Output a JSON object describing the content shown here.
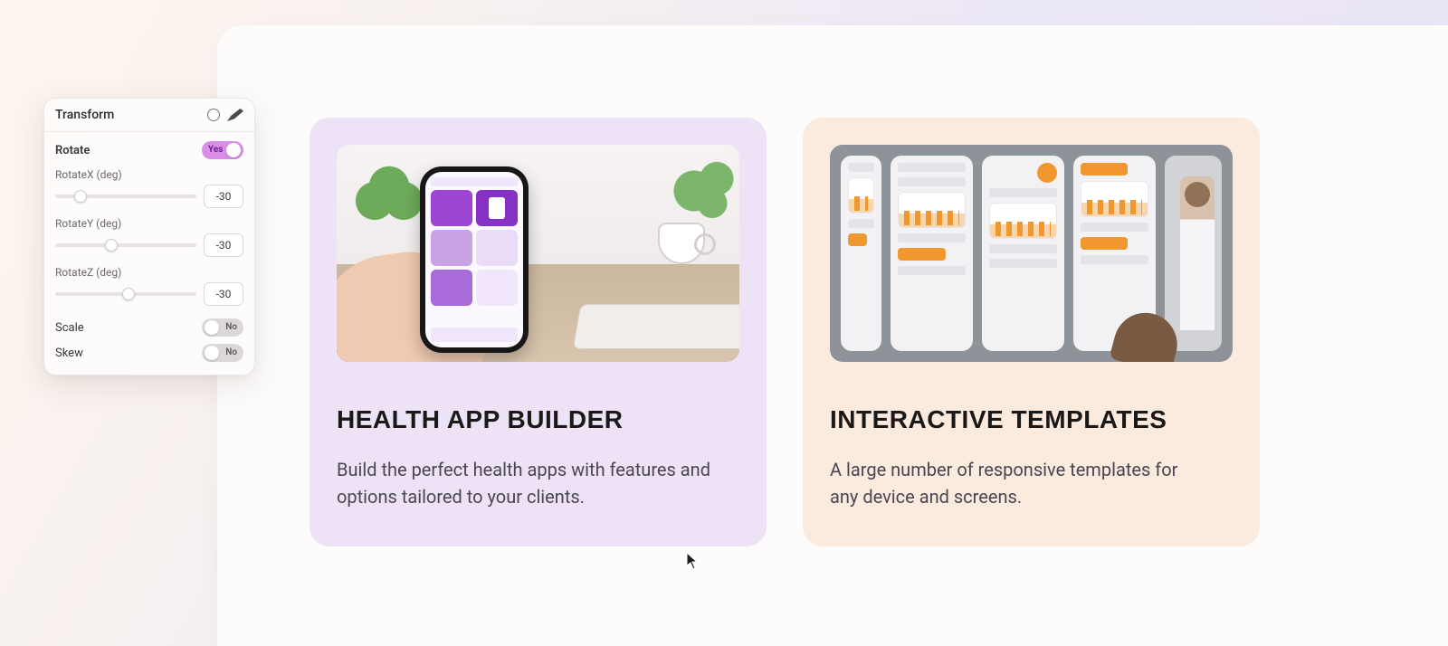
{
  "panel": {
    "title": "Transform",
    "rotate": {
      "label": "Rotate",
      "enabled": true,
      "toggle_text": "Yes",
      "x": {
        "label": "RotateX (deg)",
        "value": "-30",
        "pct": 18
      },
      "y": {
        "label": "RotateY (deg)",
        "value": "-30",
        "pct": 40
      },
      "z": {
        "label": "RotateZ (deg)",
        "value": "-30",
        "pct": 52
      }
    },
    "scale": {
      "label": "Scale",
      "enabled": false,
      "toggle_text": "No"
    },
    "skew": {
      "label": "Skew",
      "enabled": false,
      "toggle_text": "No"
    }
  },
  "cards": {
    "health": {
      "title": "HEALTH APP BUILDER",
      "desc": "Build the perfect health apps with features and options tailored to your clients."
    },
    "templates": {
      "title": "INTERACTIVE TEMPLATES",
      "desc": "A large number of responsive templates for any device and screens."
    }
  }
}
